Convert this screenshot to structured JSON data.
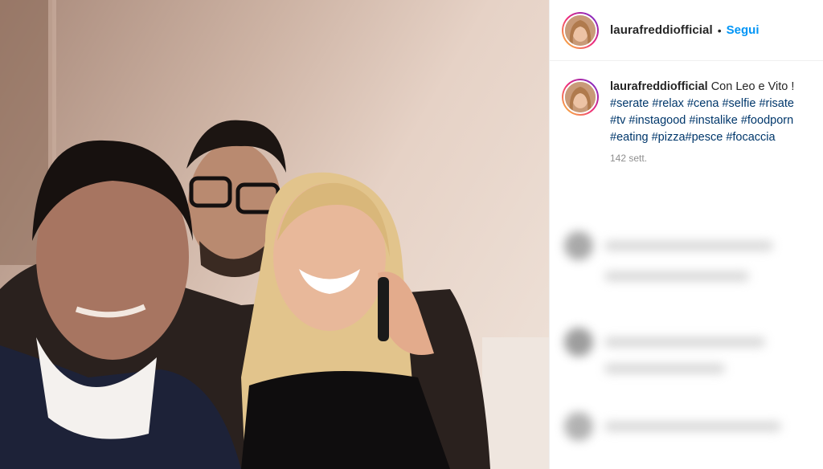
{
  "post": {
    "username": "laurafreddiofficial",
    "separator": "•",
    "follow_label": "Segui",
    "caption_user": "laurafreddiofficial",
    "caption_text": "Con Leo e Vito !",
    "hashtags_line1": [
      "#serate",
      "#relax",
      "#cena",
      "#selfie",
      "#risate"
    ],
    "hashtags_line2": [
      "#tv",
      "#instagood",
      "#instalike",
      "#foodporn"
    ],
    "hashtags_line3": [
      "#eating",
      "#pizza#pesce",
      "#focaccia"
    ],
    "time_ago": "142 sett."
  },
  "colors": {
    "follow": "#0095f6",
    "hashtag": "#00376b",
    "muted": "#8e8e8e",
    "text": "#262626"
  }
}
